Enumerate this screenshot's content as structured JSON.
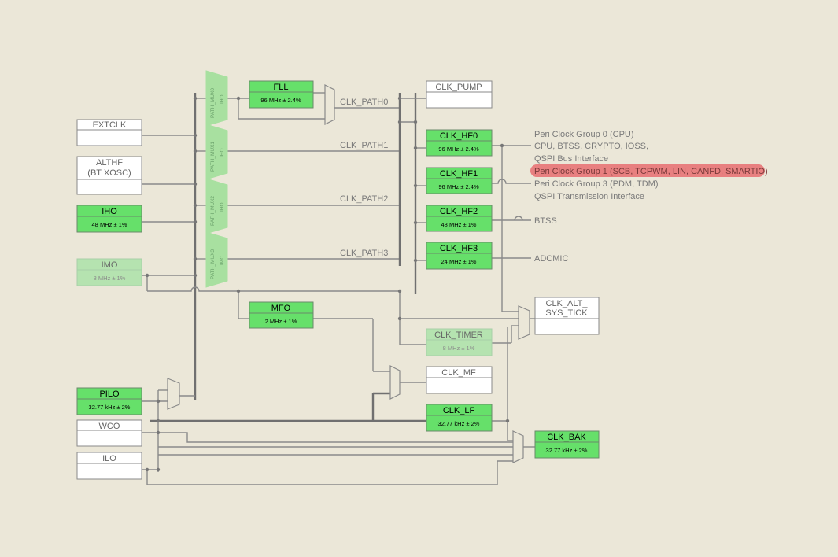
{
  "sources": {
    "extclk": {
      "title": "EXTCLK"
    },
    "althf": {
      "title1": "ALTHF",
      "title2": "(BT XOSC)"
    },
    "iho": {
      "title": "IHO",
      "freq": "48 MHz ± 1%"
    },
    "imo": {
      "title": "IMO",
      "freq": "8 MHz ± 1%"
    },
    "pilo": {
      "title": "PILO",
      "freq": "32.77 kHz ± 2%"
    },
    "wco": {
      "title": "WCO"
    },
    "ilo": {
      "title": "ILO"
    }
  },
  "path_mux": {
    "mux0": {
      "name": "PATH_MUX0",
      "sel": "IHO"
    },
    "mux1": {
      "name": "PATH_MUX1",
      "sel": "IHO"
    },
    "mux2": {
      "name": "PATH_MUX2",
      "sel": "IHO"
    },
    "mux3": {
      "name": "PATH_MUX3",
      "sel": "IMO"
    }
  },
  "fll": {
    "title": "FLL",
    "freq": "96 MHz ± 2.4%"
  },
  "mfo": {
    "title": "MFO",
    "freq": "2 MHz ± 1%"
  },
  "paths": [
    "CLK_PATH0",
    "CLK_PATH1",
    "CLK_PATH2",
    "CLK_PATH3"
  ],
  "outputs": {
    "clk_pump": {
      "title": "CLK_PUMP"
    },
    "clk_hf0": {
      "title": "CLK_HF0",
      "freq": "96 MHz ± 2.4%"
    },
    "clk_hf1": {
      "title": "CLK_HF1",
      "freq": "96 MHz ± 2.4%"
    },
    "clk_hf2": {
      "title": "CLK_HF2",
      "freq": "48 MHz ± 1%"
    },
    "clk_hf3": {
      "title": "CLK_HF3",
      "freq": "24 MHz ± 1%"
    },
    "clk_alt_sys_tick": {
      "title1": "CLK_ALT_",
      "title2": "SYS_TICK"
    },
    "clk_timer": {
      "title": "CLK_TIMER",
      "freq": "8 MHz ± 1%"
    },
    "clk_mf": {
      "title": "CLK_MF"
    },
    "clk_lf": {
      "title": "CLK_LF",
      "freq": "32.77 kHz ± 2%"
    },
    "clk_bak": {
      "title": "CLK_BAK",
      "freq": "32.77 kHz ± 2%"
    }
  },
  "peri_labels": {
    "group0": "Peri Clock Group 0 (CPU)",
    "group0_line2": "CPU, BTSS, CRYPTO, IOSS,",
    "group0_line3": "QSPI Bus Interface",
    "group1": "Peri Clock Group 1 (SCB, TCPWM, LIN, CANFD, SMARTIO)",
    "group3": "Peri Clock Group 3 (PDM, TDM)",
    "group3_line2": "QSPI Transmission Interface",
    "btss": "BTSS",
    "adcmic": "ADCMIC"
  },
  "colors": {
    "active_green": "#66e06a",
    "dim_green": "#b5e3b0",
    "mux_green": "#a8e0a0",
    "highlight": "#e88080",
    "wire": "#8a8a8a"
  }
}
